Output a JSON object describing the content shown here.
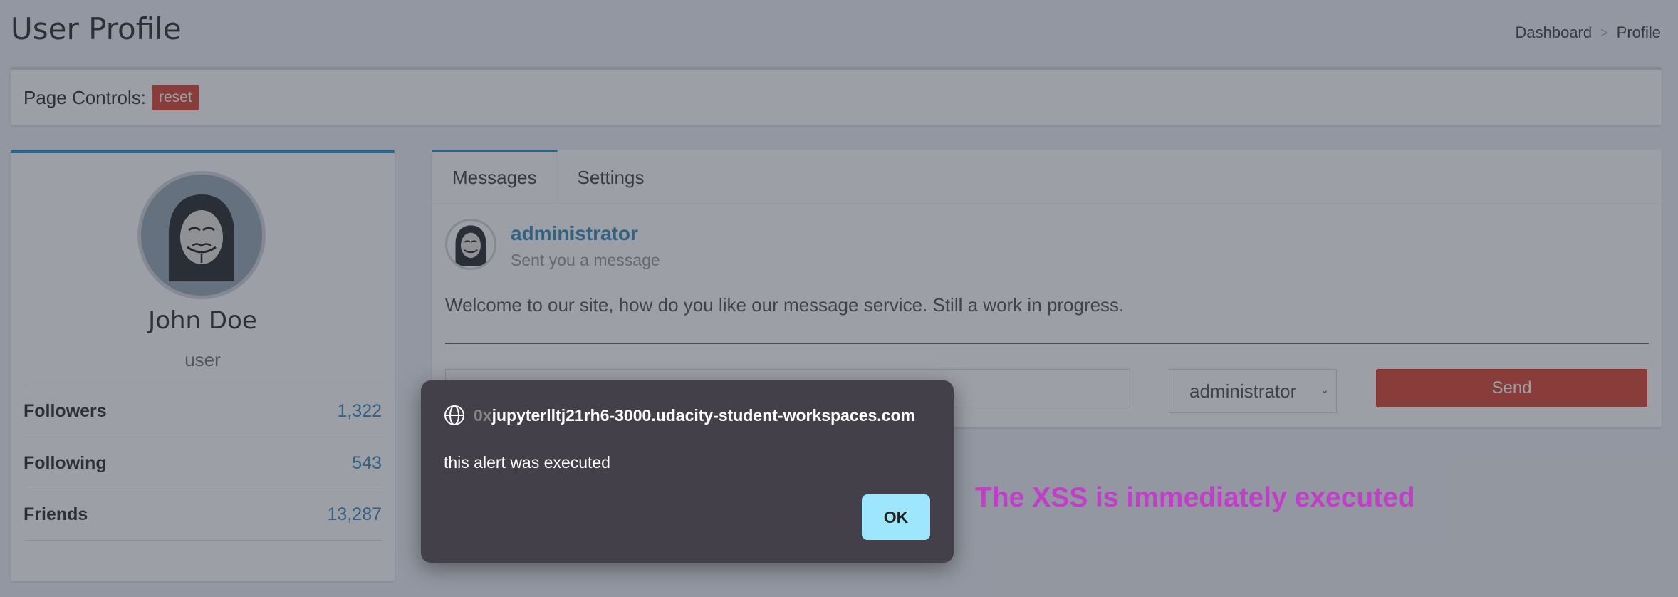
{
  "page": {
    "title": "User Profile",
    "breadcrumb": [
      "Dashboard",
      "Profile"
    ],
    "breadcrumb_separator": ">"
  },
  "controls": {
    "label": "Page Controls:",
    "reset_label": "reset"
  },
  "profile": {
    "name": "John Doe",
    "role": "user",
    "stats": [
      {
        "label": "Followers",
        "value": "1,322"
      },
      {
        "label": "Following",
        "value": "543"
      },
      {
        "label": "Friends",
        "value": "13,287"
      }
    ]
  },
  "messages": {
    "tabs": [
      {
        "label": "Messages",
        "active": true
      },
      {
        "label": "Settings",
        "active": false
      }
    ],
    "sender": "administrator",
    "sender_subtitle": "Sent you a message",
    "body": "Welcome to our site, how do you like our message service. Still a work in progress.",
    "input_value": "",
    "recipient": "administrator",
    "send_label": "Send"
  },
  "alert": {
    "origin_faded": "0x",
    "origin": "jupyterlltj21rh6-3000.udacity-student-workspaces.com",
    "message": "this alert was executed",
    "ok_label": "OK"
  },
  "annotation": "The XSS is immediately executed",
  "colors": {
    "primary": "#3c8dbc",
    "danger": "#dd4b39",
    "annotation": "#c13fc8",
    "dialog_bg": "#434049",
    "ok_button": "#9ee6fb"
  },
  "icons": {
    "avatar": "guy-fawkes-mask-avatar",
    "origin": "globe-icon"
  }
}
